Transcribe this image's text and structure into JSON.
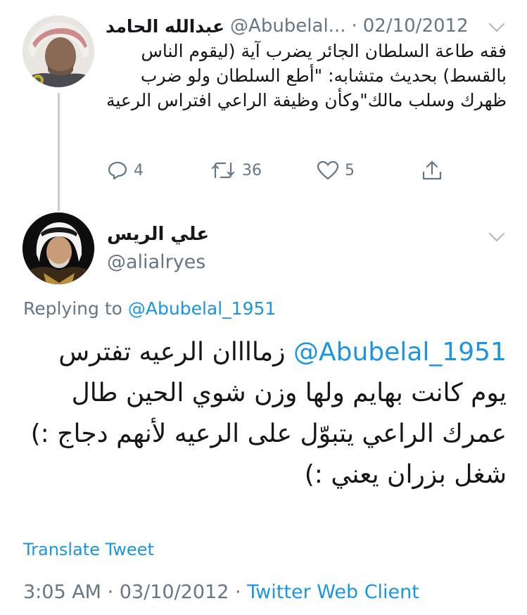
{
  "tweet1": {
    "name": "عبدالله الحامد",
    "handle": "@Abubelal...",
    "separator": "·",
    "date": "02/10/2012",
    "text": "فقه طاعة السلطان الجائر يضرب آية (ليقوم الناس بالقسط) بحديث متشابه: \"أطع السلطان ولو ضرب ظهرك وسلب مالك\"وكأن وظيفة الراعي افتراس الرعية",
    "actions": {
      "reply_count": "4",
      "retweet_count": "36",
      "like_count": "5"
    }
  },
  "tweet2": {
    "name": "علي الريس",
    "handle": "@alialryes",
    "replying_prefix": "Replying to",
    "replying_handle": "@Abubelal_1951",
    "mention": "@Abubelal_1951",
    "text": "زماااان الرعيه تفترس يوم كانت بهايم ولها وزن شوي الحين طال عمرك الراعي يتبوّل على الرعيه لأنهم دجاج :) شغل بزران يعني :)",
    "translate_label": "Translate Tweet",
    "time": "3:05 AM",
    "date": "03/10/2012",
    "source": "Twitter Web Client",
    "separator": "·"
  },
  "icons": {
    "reply": "reply-icon",
    "retweet": "retweet-icon",
    "like": "heart-icon",
    "share": "share-icon",
    "more": "chevron-down-icon"
  },
  "colors": {
    "link": "#1b95e0",
    "muted": "#657786",
    "text": "#14171a",
    "thread_line": "#c4cfd6"
  }
}
